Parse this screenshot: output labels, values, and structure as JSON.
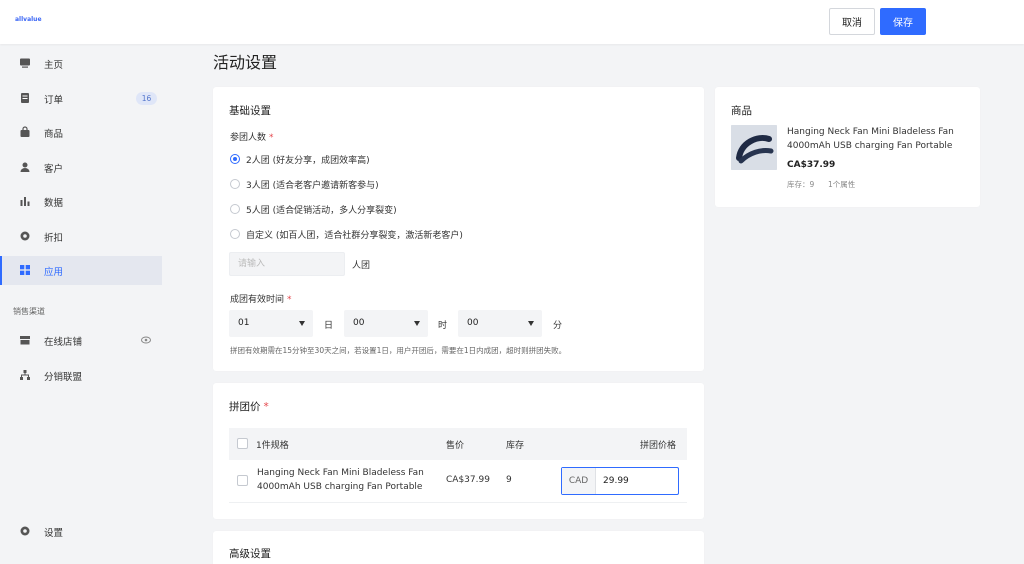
{
  "topbar": {
    "logo": "allvalue",
    "cancel_label": "取消",
    "save_label": "保存"
  },
  "sidebar": {
    "items": [
      {
        "label": "主页",
        "icon": "monitor-icon"
      },
      {
        "label": "订单",
        "icon": "order-icon",
        "badge": "16"
      },
      {
        "label": "商品",
        "icon": "bag-icon"
      },
      {
        "label": "客户",
        "icon": "user-icon"
      },
      {
        "label": "数据",
        "icon": "bar-chart-icon"
      },
      {
        "label": "折扣",
        "icon": "gear-discount-icon"
      },
      {
        "label": "应用",
        "icon": "apps-grid-icon",
        "active": true
      }
    ],
    "section_title": "销售渠道",
    "channels": [
      {
        "label": "在线店铺",
        "icon": "store-icon"
      },
      {
        "label": "分销联盟",
        "icon": "network-icon"
      }
    ],
    "settings_label": "设置"
  },
  "main": {
    "page_title": "活动设置",
    "basic": {
      "title": "基础设置",
      "group_size_label": "参团人数",
      "options": [
        "2人团 (好友分享，成团效率高)",
        "3人团 (适合老客户邀请新客参与)",
        "5人团 (适合促销活动，多人分享裂变)",
        "自定义 (如百人团，适合社群分享裂变，激活新老客户)"
      ],
      "selected_index": 0,
      "custom_placeholder": "请输入",
      "custom_unit": "人团",
      "validity_label": "成团有效时间",
      "day_value": "01",
      "day_unit": "日",
      "hour_value": "00",
      "hour_unit": "时",
      "minute_value": "00",
      "minute_unit": "分",
      "hint": "拼团有效期需在15分钟至30天之间，若设置1日，用户开团后，需要在1日内成团，超时则拼团失败。"
    },
    "group_price": {
      "title": "拼团价",
      "columns": [
        "1件规格",
        "售价",
        "库存",
        "拼团价格"
      ],
      "rows": [
        {
          "name_line1": "Hanging Neck Fan Mini Bladeless Fan",
          "name_line2": "4000mAh USB charging Fan Portable",
          "price": "CA$37.99",
          "stock": "9",
          "currency": "CAD",
          "group_price": "29.99"
        }
      ]
    },
    "advanced": {
      "title": "高级设置"
    }
  },
  "product": {
    "title": "商品",
    "name_line1": "Hanging Neck Fan Mini Bladeless Fan",
    "name_line2": "4000mAh USB charging Fan Portable",
    "price": "CA$37.99",
    "stock_label": "库存：9",
    "attrs": "1个属性"
  },
  "colors": {
    "accent": "#2f6bff",
    "required": "#e5484d"
  }
}
